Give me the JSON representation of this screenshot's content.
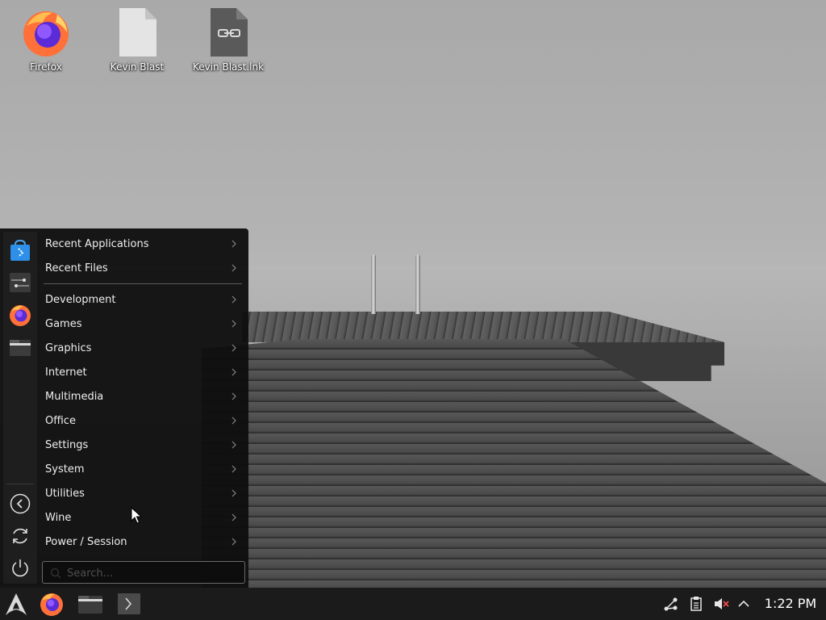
{
  "desktop": {
    "icons": [
      {
        "label": "Firefox",
        "icon": "firefox-icon"
      },
      {
        "label": "Kevin Blast",
        "icon": "text-file-icon"
      },
      {
        "label": "Kevin Blast.lnk",
        "icon": "link-file-icon"
      }
    ]
  },
  "app_menu": {
    "favorites": [
      {
        "icon": "software-store-icon"
      },
      {
        "icon": "system-settings-icon"
      },
      {
        "icon": "firefox-icon"
      },
      {
        "icon": "file-manager-icon"
      }
    ],
    "actions": [
      {
        "icon": "back-arrow-icon"
      },
      {
        "icon": "restart-icon"
      },
      {
        "icon": "power-icon"
      }
    ],
    "items": [
      {
        "label": "Recent Applications"
      },
      {
        "label": "Recent Files"
      },
      {
        "label": "Development"
      },
      {
        "label": "Games"
      },
      {
        "label": "Graphics"
      },
      {
        "label": "Internet"
      },
      {
        "label": "Multimedia"
      },
      {
        "label": "Office"
      },
      {
        "label": "Settings"
      },
      {
        "label": "System"
      },
      {
        "label": "Utilities"
      },
      {
        "label": "Wine"
      },
      {
        "label": "Power / Session"
      }
    ],
    "search": {
      "placeholder": "Search...",
      "value": ""
    }
  },
  "taskbar": {
    "launchers": [
      {
        "icon": "arch-launcher-icon"
      },
      {
        "icon": "firefox-icon"
      },
      {
        "icon": "file-manager-icon"
      },
      {
        "icon": "terminal-icon"
      }
    ],
    "tray": [
      {
        "icon": "network-icon"
      },
      {
        "icon": "clipboard-icon"
      },
      {
        "icon": "volume-muted-icon"
      },
      {
        "icon": "chevron-up-icon"
      }
    ],
    "clock": "1:22 PM"
  }
}
